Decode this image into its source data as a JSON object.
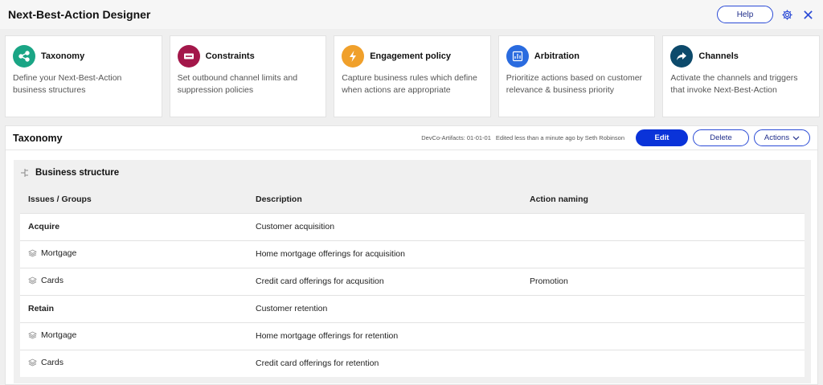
{
  "header": {
    "title": "Next-Best-Action Designer",
    "help_label": "Help"
  },
  "cards": [
    {
      "title": "Taxonomy",
      "desc": "Define your Next-Best-Action business structures",
      "color": "#1aa585",
      "icon": "taxonomy-icon"
    },
    {
      "title": "Constraints",
      "desc": "Set outbound channel limits and suppression policies",
      "color": "#a3174a",
      "icon": "constraints-icon"
    },
    {
      "title": "Engagement policy",
      "desc": "Capture business rules which define when actions are appropriate",
      "color": "#f0a02b",
      "icon": "lightning-icon"
    },
    {
      "title": "Arbitration",
      "desc": "Prioritize actions based on customer relevance & business priority",
      "color": "#2a6bdf",
      "icon": "arbitration-icon"
    },
    {
      "title": "Channels",
      "desc": "Activate the channels and triggers that invoke Next-Best-Action",
      "color": "#0d4a6b",
      "icon": "share-arrow-icon"
    }
  ],
  "panel": {
    "title": "Taxonomy",
    "artifact": "DevCo-Artifacts: 01-01-01",
    "edited": "Edited less than a minute ago by Seth Robinson",
    "edit_label": "Edit",
    "delete_label": "Delete",
    "actions_label": "Actions"
  },
  "section": {
    "title": "Business structure",
    "columns": [
      "Issues / Groups",
      "Description",
      "Action naming"
    ],
    "rows": [
      {
        "name": "Acquire",
        "description": "Customer acquisition",
        "naming": "",
        "level": "issue"
      },
      {
        "name": "Mortgage",
        "description": "Home mortgage offerings for acquisition",
        "naming": "",
        "level": "group"
      },
      {
        "name": "Cards",
        "description": "Credit card offerings for acqusition",
        "naming": "Promotion",
        "level": "group"
      },
      {
        "name": "Retain",
        "description": "Customer retention",
        "naming": "",
        "level": "issue"
      },
      {
        "name": "Mortgage",
        "description": "Home mortgage offerings for retention",
        "naming": "",
        "level": "group"
      },
      {
        "name": "Cards",
        "description": "Credit card offerings for retention",
        "naming": "",
        "level": "group"
      }
    ]
  }
}
